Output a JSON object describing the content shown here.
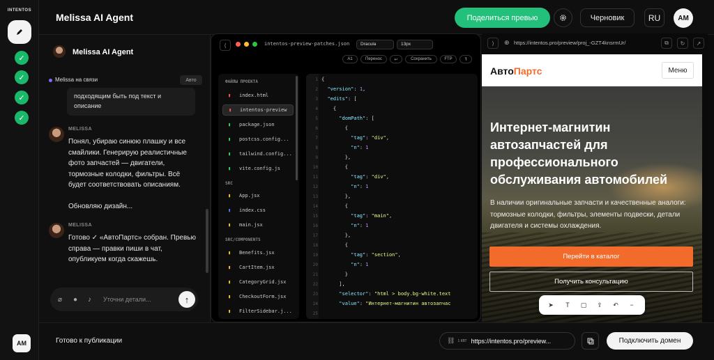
{
  "brand": "INTENTOS",
  "colors": {
    "accent": "#22c07a",
    "online": "#7e6bff",
    "orange": "#f26b2a"
  },
  "rail": {
    "user_initials": "AM",
    "steps_done": 4
  },
  "header": {
    "title": "Melissa AI Agent",
    "share_label": "Поделиться превью",
    "draft_label": "Черновик",
    "language": "RU",
    "user_initials": "AM"
  },
  "chat": {
    "agent_name": "Melissa AI Agent",
    "status_text": "Melissa на связи",
    "mode": "Авто",
    "quote": "подходящим быть под текст и описание",
    "messages": [
      {
        "author": "MELISSA",
        "text": "Понял, убираю синюю плашку и все смайлики. Генерирую реалистичные фото запчастей — двигатели, тормозные колодки, фильтры. Всё будет соответствовать описаниям.",
        "text2": "Обновляю дизайн..."
      },
      {
        "author": "MELISSA",
        "text": "Готово ✓ «АвтоПартс» собран. Превью справа — правки пиши в чат, опубликуем когда скажешь."
      }
    ],
    "input_placeholder": "Уточни детали..."
  },
  "editor": {
    "file_name": "intentos-preview-patches.json",
    "theme": "Dracula",
    "font_size": "13px",
    "toolbar": [
      "A1",
      "Перенос",
      "↩",
      "Сохранить",
      "FTP",
      "ꟻ"
    ],
    "sections": [
      "ФАЙЛЫ ПРОЕКТА",
      "SRC",
      "SRC/COMPONENTS"
    ],
    "root_files": [
      "index.html",
      "intentos-preview",
      "package.json",
      "postcss.config...",
      "tailwind.config...",
      "vite.config.js"
    ],
    "src_files": [
      "App.jsx",
      "index.css",
      "main.jsx"
    ],
    "component_files": [
      "Benefits.jsx",
      "CartItem.jsx",
      "CategoryGrid.jsx",
      "CheckoutForm.jsx",
      "FilterSidebar.j..."
    ],
    "line_numbers": [
      "1",
      "2",
      "3",
      "4",
      "5",
      "6",
      "7",
      "8",
      "9",
      "10",
      "11",
      "12",
      "13",
      "14",
      "15",
      "16",
      "17",
      "18",
      "19",
      "20",
      "21",
      "22",
      "23",
      "24",
      "25"
    ],
    "code_lines": [
      "{",
      "  \"version\": 1,",
      "  \"edits\": [",
      "    {",
      "      \"domPath\": [",
      "        {",
      "          \"tag\": \"div\",",
      "          \"n\": 1",
      "        },",
      "        {",
      "          \"tag\": \"div\",",
      "          \"n\": 1",
      "        },",
      "        {",
      "          \"tag\": \"main\",",
      "          \"n\": 1",
      "        },",
      "        {",
      "          \"tag\": \"section\",",
      "          \"n\": 1",
      "        }",
      "      ],",
      "      \"selector\": \"html > body.bg-white.text",
      "      \"value\": \"Интернет-магнитин автозапчас",
      ""
    ]
  },
  "preview": {
    "url": "https://intentos.pro/preview/proj_-GZT4knsrmUr/",
    "logo_part1": "Авто",
    "logo_part2": "Партс",
    "menu_label": "Меню",
    "hero_title": "Интернет-магнитин автозапчастей для профессионального обслуживания автомобилей",
    "hero_text": "В наличии оригинальные запчасти и качественные аналоги: тормозные колодки, фильтры, элементы подвески, детали двигателя и системы охлаждения.",
    "cta_primary": "Перейти в каталог",
    "cta_secondary": "Получить консультацию"
  },
  "footer": {
    "status": "Готово к публикации",
    "link_size": "1 КВТ",
    "link_text": "https://intentos.pro/preview...",
    "connect_domain": "Подключить домен"
  }
}
